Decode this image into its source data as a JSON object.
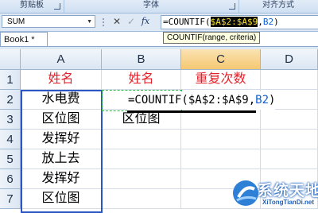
{
  "ribbon": {
    "groups": [
      {
        "label": "剪贴板"
      },
      {
        "label": "字体"
      },
      {
        "label": "对齐方式"
      }
    ]
  },
  "formula_bar": {
    "name_box": "SUM",
    "cancel_symbol": "✕",
    "enter_symbol": "✓",
    "fx_symbol": "fx",
    "formula_prefix": "=COUNTIF(",
    "formula_selected": "$A$2:$A$9",
    "formula_sep": ",",
    "formula_ref2": "B2",
    "formula_suffix": ")"
  },
  "tooltip": {
    "text": "COUNTIF(range, criteria)"
  },
  "workbook": {
    "tab_label": "Book1 *"
  },
  "sheet": {
    "columns": [
      "A",
      "B",
      "C",
      "D"
    ],
    "rows": [
      "1",
      "2",
      "3",
      "4",
      "5",
      "6",
      "7"
    ],
    "cells": {
      "A1": "姓名",
      "B1": "姓名",
      "C1": "重复次数",
      "A2": "水电费",
      "A3": "区位图",
      "A4": "发挥好",
      "A5": "放上去",
      "A6": "发挥好",
      "A7": "区位图",
      "B3": "区位图"
    },
    "editing": {
      "prefix": "=COUNTIF($A$2:$A$9,",
      "ref2": "B2",
      "suffix": ")"
    },
    "header_color": "#e3222b",
    "range_color": "#2b56c4"
  },
  "watermark": {
    "brand": "系统天地",
    "site": "XiTongTianDi.net"
  }
}
